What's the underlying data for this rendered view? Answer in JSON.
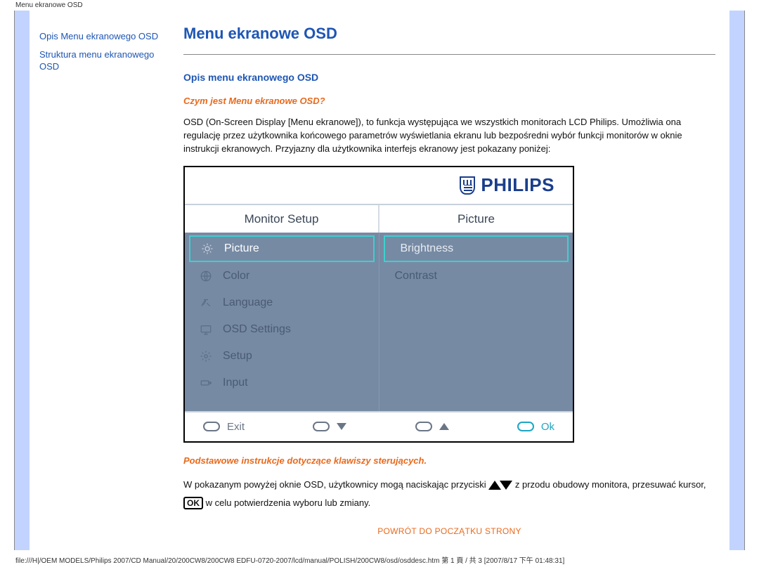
{
  "doc_header": "Menu ekranowe OSD",
  "doc_footer": "file:///H|/OEM MODELS/Philips 2007/CD Manual/20/200CW8/200CW8 EDFU-0720-2007/lcd/manual/POLISH/200CW8/osd/osddesc.htm 第 1 頁 / 共 3  [2007/8/17 下午 01:48:31]",
  "sidebar": {
    "links": [
      {
        "label": "Opis Menu ekranowego OSD"
      },
      {
        "label": "Struktura menu ekranowego OSD"
      }
    ]
  },
  "title": "Menu ekranowe OSD",
  "section1_heading": "Opis menu ekranowego OSD",
  "sub1_heading": "Czym jest Menu ekranowe OSD?",
  "para1": "OSD (On-Screen Display [Menu ekranowe]), to funkcja występująca we wszystkich monitorach LCD Philips. Umożliwia ona regulację przez użytkownika końcowego parametrów wyświetlania ekranu lub bezpośredni wybór funkcji monitorów w oknie instrukcji ekranowych. Przyjazny dla użytkownika interfejs ekranowy jest pokazany poniżej:",
  "osd": {
    "brand": "PHILIPS",
    "col_left_header": "Monitor Setup",
    "col_right_header": "Picture",
    "left_items": [
      {
        "icon": "sun-icon",
        "label": "Picture",
        "state": "selected"
      },
      {
        "icon": "globe-icon",
        "label": "Color",
        "state": "dim"
      },
      {
        "icon": "language-icon",
        "label": "Language",
        "state": "dim"
      },
      {
        "icon": "monitor-icon",
        "label": "OSD Settings",
        "state": "dim"
      },
      {
        "icon": "gear-icon",
        "label": "Setup",
        "state": "dim"
      },
      {
        "icon": "input-icon",
        "label": "Input",
        "state": "dim"
      }
    ],
    "right_items": [
      {
        "label": "Brightness",
        "state": "selected"
      },
      {
        "label": "Contrast",
        "state": "dim"
      }
    ],
    "footer": {
      "exit": "Exit",
      "ok": "Ok"
    }
  },
  "sub2_heading": "Podstawowe instrukcje dotyczące klawiszy sterujących.",
  "para2a": "W pokazanym powyżej oknie OSD, użytkownicy mogą naciskając przyciski",
  "para2b": " z przodu obudowy monitora, przesuwać kursor,",
  "para2c": " w celu potwierdzenia wyboru lub zmiany.",
  "ok_glyph": "OK",
  "back_to_top": "POWRÓT DO POCZĄTKU STRONY"
}
